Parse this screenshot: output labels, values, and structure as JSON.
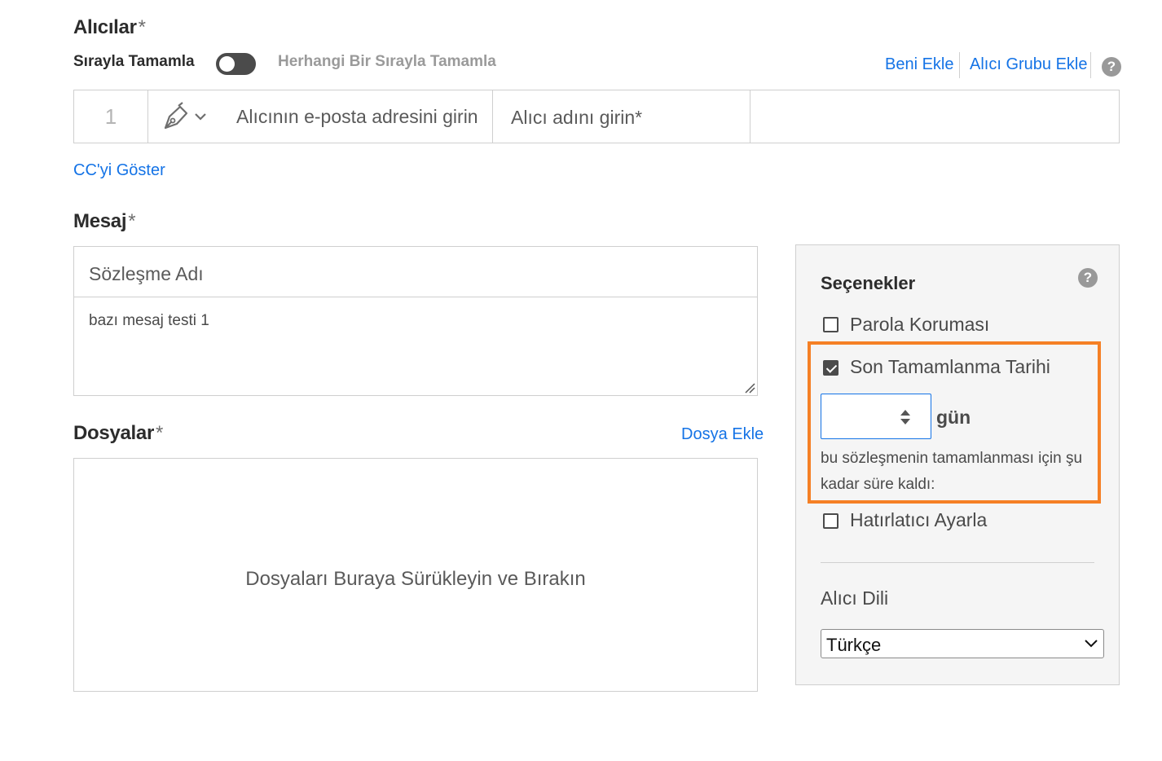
{
  "recipients": {
    "title": "Alıcılar",
    "required_mark": "*",
    "sequence_label": "Sırayla Tamamla",
    "any_order_label": "Herhangi Bir Sırayla Tamamla",
    "add_me_link": "Beni Ekle",
    "add_group_link": "Alıcı Grubu Ekle",
    "help": "?",
    "row": {
      "index": "1",
      "email_placeholder": "Alıcının e-posta adresini girin",
      "name_placeholder": "Alıcı adını girin*"
    },
    "show_cc_link": "CC'yi Göster"
  },
  "message": {
    "title": "Mesaj",
    "required_mark": "*",
    "agreement_name_placeholder": "Sözleşme Adı",
    "body_text": "bazı mesaj testi 1"
  },
  "files": {
    "title": "Dosyalar",
    "required_mark": "*",
    "add_file_link": "Dosya Ekle",
    "drop_text": "Dosyaları Buraya Sürükleyin ve Bırakın"
  },
  "options": {
    "title": "Seçenekler",
    "help": "?",
    "password_protection": "Parola Koruması",
    "completion_deadline": "Son Tamamlanma Tarihi",
    "days_unit": "gün",
    "deadline_hint": "bu sözleşmenin tamamlanması için şu kadar süre kaldı:",
    "set_reminder": "Hatırlatıcı Ayarla",
    "recipient_language_label": "Alıcı Dili",
    "recipient_language_value": "Türkçe"
  },
  "colors": {
    "link": "#1473e6",
    "highlight": "#f58025",
    "panel_bg": "#f5f5f5"
  }
}
